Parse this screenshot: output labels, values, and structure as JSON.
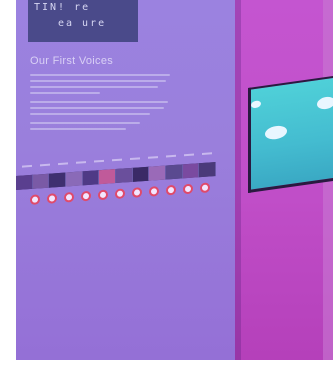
{
  "photo": {
    "description_free": true,
    "poster": {
      "line1": "TIN! re",
      "line2": "ea ure"
    },
    "panel": {
      "heading": "Our First Voices"
    },
    "timeline": {
      "tick_count": 11,
      "photo_count": 12,
      "dot_count": 11
    },
    "colors": {
      "left_wall": "#9a7fdc",
      "right_wall": "#c14fc9",
      "tv_screen": "#44bcd0",
      "dot_outline": "#e04a6a"
    }
  }
}
